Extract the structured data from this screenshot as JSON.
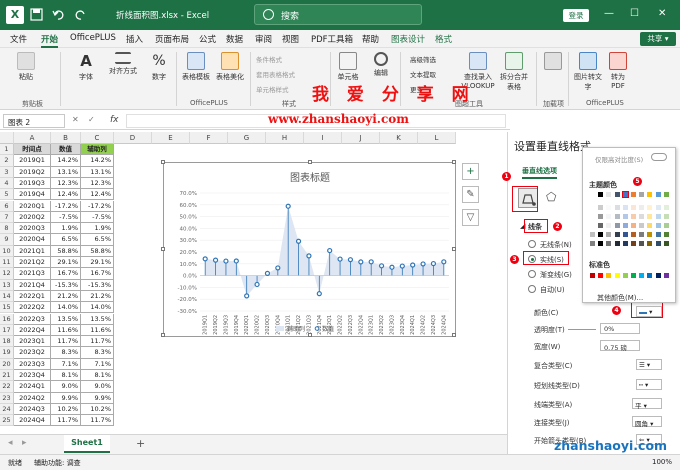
{
  "titlebar": {
    "filename": "折线面积图.xlsx",
    "app": "Excel",
    "search_placeholder": "搜索",
    "login_label": "登录",
    "minimize": "—",
    "restore": "☐",
    "close": "✕"
  },
  "menu": {
    "items": [
      "文件",
      "开始",
      "OfficePLUS",
      "插入",
      "页面布局",
      "公式",
      "数据",
      "审阅",
      "视图",
      "PDF工具箱",
      "帮助"
    ],
    "context_tabs": [
      "图表设计",
      "格式"
    ],
    "active": "开始",
    "share_label": "共享"
  },
  "ribbon": {
    "paste": "粘贴",
    "font": "字体",
    "align": "对齐方式",
    "number": "数字",
    "table_template": "表格模板",
    "table_beautify": "表格美化",
    "cond_format": "条件格式",
    "table_format": "套用表格格式",
    "cell_style": "单元格样式",
    "cells": "单元格",
    "edit": "编辑",
    "filter": "高级筛选",
    "text_extract": "文本提取",
    "more": "更多",
    "lookup": "查找录入 VLOOKUP",
    "split": "拆分合并 表格",
    "addins": "加载项",
    "pic_to_text": "图片转文字",
    "to_pdf": "转为PDF",
    "groups": {
      "clipboard": "剪贴板",
      "officeplus": "OfficePLUS",
      "styles": "样式",
      "tools": "图超工具",
      "addins": "加载项",
      "officeplus2": "OfficePLUS"
    }
  },
  "watermark": {
    "title": "我 爱 分 享 网",
    "url": "www.zhanshaoyi.com",
    "bottom": "zhanshaoyi.com"
  },
  "formula_bar": {
    "name_box": "图表 2",
    "fx": "fx"
  },
  "sheet": {
    "columns": [
      "A",
      "B",
      "C",
      "D",
      "E",
      "F",
      "G",
      "H",
      "I",
      "J",
      "K",
      "L"
    ],
    "headers": [
      "时间点",
      "数值",
      "辅助列"
    ],
    "rows": [
      [
        "2019Q1",
        "14.2%",
        "14.2%"
      ],
      [
        "2019Q2",
        "13.1%",
        "13.1%"
      ],
      [
        "2019Q3",
        "12.3%",
        "12.3%"
      ],
      [
        "2019Q4",
        "12.4%",
        "12.4%"
      ],
      [
        "2020Q1",
        "-17.2%",
        "-17.2%"
      ],
      [
        "2020Q2",
        "-7.5%",
        "-7.5%"
      ],
      [
        "2020Q3",
        "1.9%",
        "1.9%"
      ],
      [
        "2020Q4",
        "6.5%",
        "6.5%"
      ],
      [
        "2021Q1",
        "58.8%",
        "58.8%"
      ],
      [
        "2021Q2",
        "29.1%",
        "29.1%"
      ],
      [
        "2021Q3",
        "16.7%",
        "16.7%"
      ],
      [
        "2021Q4",
        "-15.3%",
        "-15.3%"
      ],
      [
        "2022Q1",
        "21.2%",
        "21.2%"
      ],
      [
        "2022Q2",
        "14.0%",
        "14.0%"
      ],
      [
        "2022Q3",
        "13.5%",
        "13.5%"
      ],
      [
        "2022Q4",
        "11.6%",
        "11.6%"
      ],
      [
        "2023Q1",
        "11.7%",
        "11.7%"
      ],
      [
        "2023Q2",
        "8.3%",
        "8.3%"
      ],
      [
        "2023Q3",
        "7.1%",
        "7.1%"
      ],
      [
        "2023Q4",
        "8.1%",
        "8.1%"
      ],
      [
        "2024Q1",
        "9.0%",
        "9.0%"
      ],
      [
        "2024Q2",
        "9.9%",
        "9.9%"
      ],
      [
        "2024Q3",
        "10.2%",
        "10.2%"
      ],
      [
        "2024Q4",
        "11.7%",
        "11.7%"
      ]
    ],
    "tab": "Sheet1",
    "add_sheet": "+"
  },
  "chart_data": {
    "type": "line",
    "title": "图表标题",
    "categories": [
      "2019Q1",
      "2019Q2",
      "2019Q3",
      "2019Q4",
      "2020Q1",
      "2020Q2",
      "2020Q3",
      "2020Q4",
      "2021Q1",
      "2021Q2",
      "2021Q3",
      "2021Q4",
      "2022Q1",
      "2022Q2",
      "2022Q3",
      "2022Q4",
      "2023Q1",
      "2023Q2",
      "2023Q3",
      "2023Q4",
      "2024Q1",
      "2024Q2",
      "2024Q3",
      "2024Q4"
    ],
    "series": [
      {
        "name": "辅助列",
        "type": "area",
        "values": [
          14.2,
          13.1,
          12.3,
          12.4,
          -17.2,
          -7.5,
          1.9,
          6.5,
          58.8,
          29.1,
          16.7,
          -15.3,
          21.2,
          14.0,
          13.5,
          11.6,
          11.7,
          8.3,
          7.1,
          8.1,
          9.0,
          9.9,
          10.2,
          11.7
        ]
      },
      {
        "name": "数值",
        "type": "line",
        "values": [
          14.2,
          13.1,
          12.3,
          12.4,
          -17.2,
          -7.5,
          1.9,
          6.5,
          58.8,
          29.1,
          16.7,
          -15.3,
          21.2,
          14.0,
          13.5,
          11.6,
          11.7,
          8.3,
          7.1,
          8.1,
          9.0,
          9.9,
          10.2,
          11.7
        ]
      }
    ],
    "yticks": [
      "70.0%",
      "60.0%",
      "50.0%",
      "40.0%",
      "30.0%",
      "20.0%",
      "10.0%",
      "0.0%",
      "-10.0%",
      "-20.0%",
      "-30.0%"
    ],
    "ylim": [
      -30,
      70
    ],
    "legend_position": "bottom",
    "colors": {
      "line": "#2e75b6",
      "area": "#dde6f2",
      "marker_fill": "#ffffff"
    }
  },
  "chart_side": {
    "add": "+",
    "brush": "🖌",
    "filter": "▽"
  },
  "pane": {
    "title": "设置垂直线格式",
    "tab": "垂直线选项",
    "section": "线条",
    "options": [
      "无线条(N)",
      "实线(S)",
      "渐变线(G)",
      "自动(U)"
    ],
    "selected": "实线(S)",
    "color_label": "颜色(C)",
    "transparency_label": "透明度(T)",
    "transparency_value": "0%",
    "width_label": "宽度(W)",
    "width_value": "0.75 磅",
    "compound_label": "复合类型(C)",
    "dash_label": "短划线类型(D)",
    "cap_label": "线端类型(A)",
    "cap_value": "平",
    "join_label": "连接类型(J)",
    "join_value": "圆角",
    "arrow_label": "开始箭头类型(B)",
    "badges": [
      "1",
      "2",
      "3",
      "4",
      "5"
    ]
  },
  "color_popup": {
    "recent_label": "仅限高对比度(S)",
    "theme_label": "主题颜色",
    "standard_label": "标准色",
    "more_label": "其他颜色(M)...",
    "theme_row": [
      "#ffffff",
      "#000000",
      "#e7e6e6",
      "#44546a",
      "#4472c4",
      "#ed7d31",
      "#a5a5a5",
      "#ffc000",
      "#5b9bd5",
      "#70ad47"
    ],
    "standard_row": [
      "#c00000",
      "#ff0000",
      "#ffc000",
      "#ffff00",
      "#92d050",
      "#00b050",
      "#00b0f0",
      "#0070c0",
      "#002060",
      "#7030a0"
    ]
  },
  "status": {
    "ready": "就绪",
    "accessibility": "辅助功能: 调查",
    "zoom": "100%"
  }
}
